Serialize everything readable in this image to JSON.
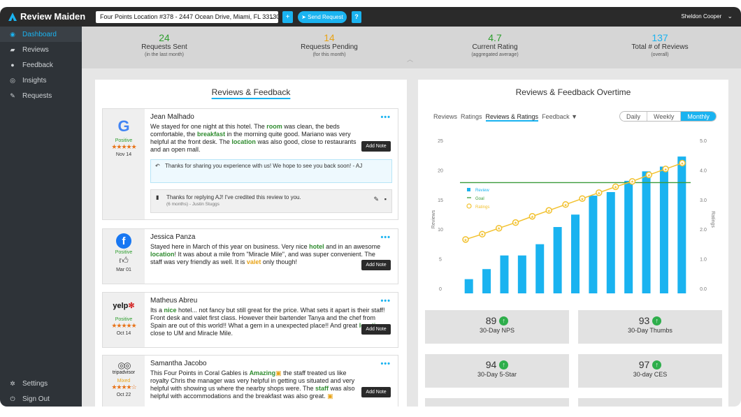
{
  "app": {
    "brand": "Review Maiden",
    "collapse_icon": "‹"
  },
  "topbar": {
    "location": "Four Points Location #378 - 2447 Ocean Drive, Miami, FL 33130",
    "plus_label": "+",
    "send_label": "Send Request",
    "help_label": "?",
    "user_name": "Sheldon Cooper"
  },
  "sidebar": {
    "items": [
      {
        "label": "Dashboard",
        "icon": "dashboard-icon"
      },
      {
        "label": "Reviews",
        "icon": "comments-icon"
      },
      {
        "label": "Feedback",
        "icon": "chat-icon"
      },
      {
        "label": "Insights",
        "icon": "eye-icon"
      },
      {
        "label": "Requests",
        "icon": "edit-icon"
      }
    ],
    "bottom": [
      {
        "label": "Settings",
        "icon": "gear-icon"
      },
      {
        "label": "Sign Out",
        "icon": "power-icon"
      }
    ]
  },
  "stats": [
    {
      "value": "24",
      "label": "Requests Sent",
      "sub": "(in the last month)",
      "color": "#2e9e2e"
    },
    {
      "value": "14",
      "label": "Requests Pending",
      "sub": "(for this month)",
      "color": "#e8a317"
    },
    {
      "value": "4.7",
      "label": "Current Rating",
      "sub": "(aggregated average)",
      "color": "#2e9e2e"
    },
    {
      "value": "137",
      "label": "Total # of Reviews",
      "sub": "(overall)",
      "color": "#1ab3f0"
    }
  ],
  "reviews_panel": {
    "title": "Reviews & Feedback",
    "add_note": "Add Note",
    "reviews": [
      {
        "name": "Jean Malhado",
        "source": "google",
        "sentiment": "Positive",
        "rating": "★★★★★",
        "date": "Nov 14",
        "text": [
          "We stayed for one night at this hotel. The ",
          "room",
          " was clean, the beds comfortable, the ",
          "breakfast",
          " in the morning quite good. Mariano was very helpful at the front desk. The ",
          "location",
          " was also good, close to restaurants and an open mall."
        ],
        "reply": "Thanks for sharing you experience with us! We hope to see you back soon! - AJ",
        "note": "Thanks for replying AJ! I've credited this review to you.",
        "note_meta": "(6 months) - Justin Stuggs"
      },
      {
        "name": "Jessica Panza",
        "source": "facebook",
        "sentiment": "Positive",
        "date": "Mar 01",
        "text": [
          "Stayed here in March of this year on business. Very nice ",
          "hotel",
          " and in an awesome ",
          "location",
          "! It was about a mile from \"Miracle Mile\", and was super convenient. The staff was very friendly as well. It is ",
          "valet",
          " only though!"
        ]
      },
      {
        "name": "Matheus Abreu",
        "source": "yelp",
        "source_text": "yelp",
        "sentiment": "Positive",
        "rating": "★★★★★",
        "date": "Oct 14",
        "text": [
          "Its a ",
          "nice",
          " hotel... not fancy but still great for the price. What sets it apart is their staff! Front desk and valet first class. However their bartender Tanya and the chef from Spain are out of this world!! What a gem in a unexpected place!! And great ",
          "location",
          " close to UM and Miracle Mile."
        ]
      },
      {
        "name": "Samantha Jacobo",
        "source": "tripadvisor",
        "source_text": "tripadvisor",
        "sentiment": "Mixed",
        "rating": "★★★★☆",
        "date": "Oct 22",
        "text": [
          "This Four Points in Coral Gables is ",
          "Amazing",
          " the staff treated us like royalty Chris the manager was very helpful in getting us situated and very helpful with showing us where the nearby shops were. The ",
          "staff",
          " was also helpful with accommodations and the breakfast was also great. "
        ]
      }
    ]
  },
  "chart_panel": {
    "title": "Reviews & Feedback Overtime",
    "tabs": [
      "Reviews",
      "Ratings",
      "Reviews & Ratings",
      "Feedback ▼"
    ],
    "periods": [
      "Daily",
      "Weekly",
      "Monthly"
    ],
    "metrics": [
      {
        "value": "89",
        "label": "30-Day NPS"
      },
      {
        "value": "93",
        "label": "30-Day Thumbs"
      },
      {
        "value": "94",
        "label": "30-Day 5-Star"
      },
      {
        "value": "97",
        "label": "30-day CES"
      }
    ]
  },
  "chart_data": {
    "type": "bar",
    "xlabel": "",
    "ylabel": "Reviews",
    "y2label": "Ratings",
    "ylim": [
      0,
      25
    ],
    "y2lim": [
      0,
      5
    ],
    "yticks": [
      "25",
      "20",
      "15",
      "10",
      "5",
      "0"
    ],
    "y2ticks": [
      "5.0",
      "4.0",
      "3.0",
      "2.0",
      "1.0",
      "0.0"
    ],
    "legend": [
      "Review",
      "Goal",
      "Ratings"
    ],
    "legend_position": "top-left",
    "series": [
      {
        "name": "Review",
        "type": "bar",
        "color": "#1ab3f0",
        "values": [
          2.4,
          4.1,
          6.4,
          6.4,
          8.3,
          11.2,
          13.3,
          16.5,
          17.1,
          19.0,
          20.6,
          21.4,
          23.1
        ]
      },
      {
        "name": "Goal",
        "type": "line",
        "color": "#3a9b3a",
        "values": [
          18.7
        ]
      },
      {
        "name": "Ratings",
        "type": "line",
        "color": "#f2c12e",
        "values": [
          1.82,
          2.0,
          2.2,
          2.39,
          2.6,
          2.8,
          3.0,
          3.2,
          3.4,
          3.6,
          3.78,
          4.0,
          4.2,
          4.4
        ]
      }
    ]
  }
}
